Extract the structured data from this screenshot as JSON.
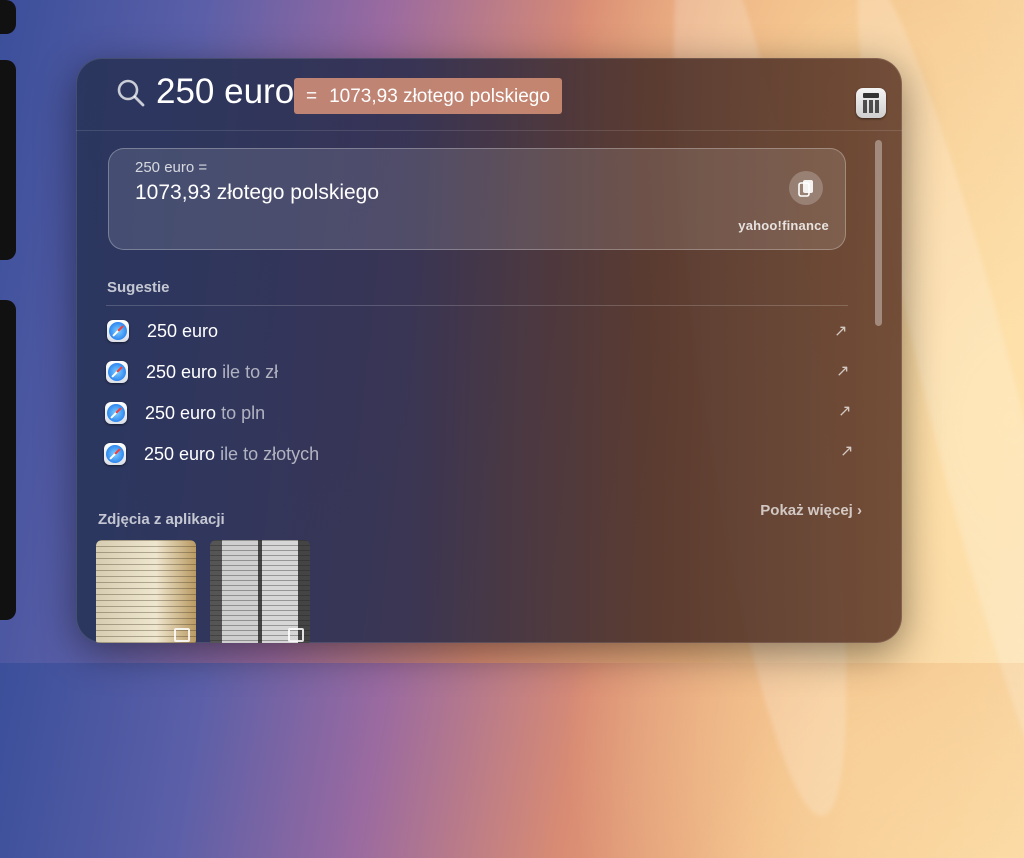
{
  "search": {
    "query": "250 euro"
  },
  "inline_result": {
    "equals": "=",
    "value": "1073,93 złotego polskiego"
  },
  "result_card": {
    "equation": "250 euro =",
    "value": "1073,93 złotego polskiego",
    "source": "yahoo!finance"
  },
  "suggestions": {
    "title": "Sugestie",
    "items": [
      {
        "bold": "250 euro",
        "rest": ""
      },
      {
        "bold": "250 euro",
        "rest": " ile to zł"
      },
      {
        "bold": "250 euro",
        "rest": " to pln"
      },
      {
        "bold": "250 euro",
        "rest": " ile to złotych"
      }
    ]
  },
  "photos": {
    "title": "Zdjęcia z aplikacji",
    "show_more": "Pokaż więcej ›"
  },
  "colors": {
    "inline_result_bg": "#de967a"
  }
}
